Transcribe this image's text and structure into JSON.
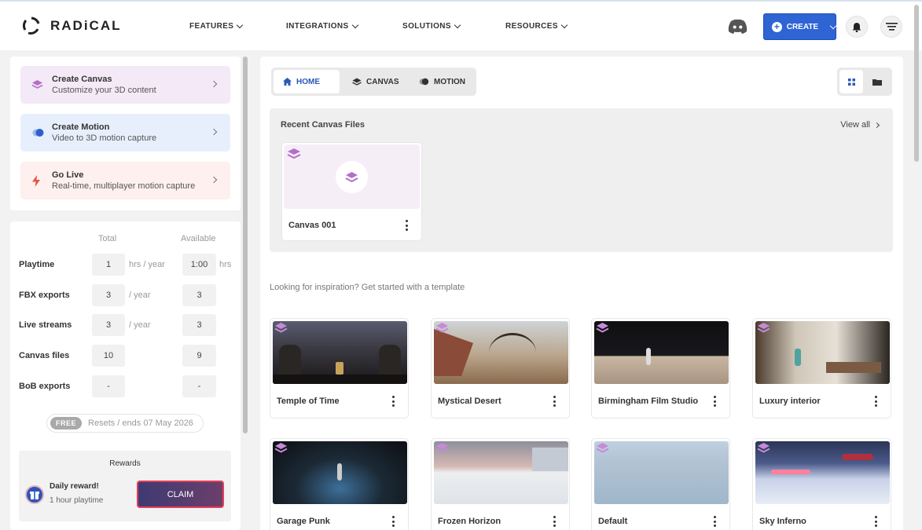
{
  "header": {
    "brand": "RADiCAL",
    "nav": [
      "FEATURES",
      "INTEGRATIONS",
      "SOLUTIONS",
      "RESOURCES"
    ],
    "create_label": "CREATE",
    "icons": [
      "discord-icon",
      "bell-icon",
      "menu-icon"
    ]
  },
  "sidebar": {
    "actions": [
      {
        "title": "Create Canvas",
        "subtitle": "Customize your 3D content",
        "icon": "layers-icon",
        "bg": "#f4e9f7"
      },
      {
        "title": "Create Motion",
        "subtitle": "Video to 3D motion capture",
        "icon": "motion-icon",
        "bg": "#e8effc"
      },
      {
        "title": "Go Live",
        "subtitle": "Real-time, multiplayer motion capture",
        "icon": "lightning-icon",
        "bg": "#fdf0ee"
      }
    ],
    "quota": {
      "col_total": "Total",
      "col_available": "Available",
      "rows": [
        {
          "label": "Playtime",
          "total": "1",
          "unit": "hrs / year",
          "available": "1:00",
          "available_unit": "hrs"
        },
        {
          "label": "FBX exports",
          "total": "3",
          "unit": "/ year",
          "available": "3",
          "available_unit": ""
        },
        {
          "label": "Live streams",
          "total": "3",
          "unit": "/ year",
          "available": "3",
          "available_unit": ""
        },
        {
          "label": "Canvas files",
          "total": "10",
          "unit": "",
          "available": "9",
          "available_unit": ""
        },
        {
          "label": "BoB exports",
          "total": "-",
          "unit": "",
          "available": "-",
          "available_unit": ""
        }
      ],
      "plan_tag": "FREE",
      "reset_text": "Resets / ends 07 May 2026"
    },
    "rewards": {
      "title": "Rewards",
      "daily_title": "Daily reward!",
      "daily_sub": "1 hour playtime",
      "claim_label": "CLAIM"
    }
  },
  "main": {
    "tabs": [
      {
        "label": "HOME",
        "icon": "home-icon",
        "active": true
      },
      {
        "label": "CANVAS",
        "icon": "layers-icon",
        "active": false
      },
      {
        "label": "MOTION",
        "icon": "motion-icon",
        "active": false
      }
    ],
    "recent_title": "Recent Canvas Files",
    "view_all": "View all",
    "recent_files": [
      {
        "name": "Canvas 001"
      }
    ],
    "inspiration_text": "Looking for inspiration? Get started with a template",
    "templates": [
      {
        "name": "Temple of Time"
      },
      {
        "name": "Mystical Desert"
      },
      {
        "name": "Birmingham Film Studio"
      },
      {
        "name": "Luxury interior"
      },
      {
        "name": "Garage Punk"
      },
      {
        "name": "Frozen Horizon"
      },
      {
        "name": "Default"
      },
      {
        "name": "Sky Inferno"
      }
    ]
  },
  "colors": {
    "accent": "#2e64d3",
    "claim_border": "#e53d59",
    "canvas_purple": "#b36fc7"
  }
}
